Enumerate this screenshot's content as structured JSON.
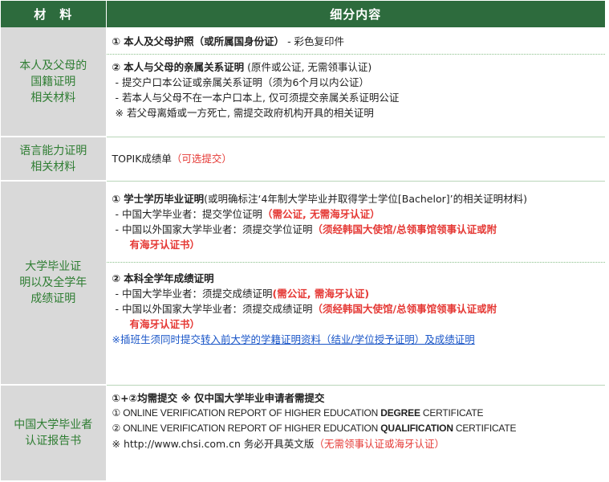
{
  "header": {
    "col1": "材　料",
    "col2": "细分内容"
  },
  "rows": [
    {
      "category": [
        "本人及父母的",
        "国籍证明",
        "相关材料"
      ],
      "block1": {
        "num": "①",
        "title": "本人及父母护照（或所属国身份证）",
        "note": "- 彩色复印件"
      },
      "block2": {
        "num": "②",
        "title": "本人与父母的亲属关系证明",
        "note": "(原件或公证, 无需领事认证)",
        "items": [
          "- 提交户口本公证或亲属关系证明（须为6个月以内公证）",
          "- 若本人与父母不在一本户口本上, 仅可须提交亲属关系证明公证"
        ],
        "remark": "※ 若父母离婚或一方死亡, 需提交政府机构开具的相关证明"
      }
    },
    {
      "category": [
        "语言能力证明",
        "相关材料"
      ],
      "text": "TOPIK成绩单",
      "optional": "（可选提交）"
    },
    {
      "category": [
        "大学毕业证",
        "明以及全学年",
        "成绩证明"
      ],
      "block1": {
        "num": "①",
        "title": "学士学历毕业证明",
        "note": "(或明确标注‘4年制大学毕业并取得学士学位[Bachelor]’的相关证明材料)",
        "item1_prefix": "- 中国大学毕业者：提交学位证明",
        "item1_red": "（需公证, 无需海牙认证）",
        "item2_prefix": "- 中国以外国家大学毕业者：须提交学位证明",
        "item2_red_a": "（须经韩国大使馆/总领事馆领事认证或附",
        "item2_red_b": "有海牙认证书）"
      },
      "block2": {
        "num": "②",
        "title": "本科全学年成绩证明",
        "item1_prefix": "- 中国大学毕业者：须提交成绩证明",
        "item1_red": "(需公证, 需海牙认证)",
        "item2_prefix": "- 中国以外国家大学毕业者：须提交成绩证明",
        "item2_red_a": "（须经韩国大使馆/总领事馆领事认证或附",
        "item2_red_b": "有海牙认证书）",
        "remark_a": "※插班生须同时提交",
        "remark_b": "转入前大学的学籍证明资料（结业/学位授予证明）及成绩证明"
      }
    },
    {
      "category": [
        "中国大学毕业者",
        "认证报告书"
      ],
      "title": "①+②均需提交 ※ 仅中国大学毕业申请者需提交",
      "line1_a": "① ONLINE VERIFICATION REPORT OF HIGHER EDUCATION ",
      "line1_b": "DEGREE",
      "line1_c": " CERTIFICATE",
      "line2_a": "② ONLINE VERIFICATION REPORT OF HIGHER EDUCATION ",
      "line2_b": "QUALIFICATION",
      "line2_c": " CERTIFICATE",
      "line3_a": "※ http://www.chsi.com.cn 务必开具英文版",
      "line3_red": "（无需领事认证或海牙认证）"
    }
  ],
  "colors": {
    "header_bg": "#2d6b3d",
    "category_bg": "#d9d9d9",
    "category_text": "#2e7d32",
    "red": "#e53935",
    "blue": "#1a56c8"
  }
}
